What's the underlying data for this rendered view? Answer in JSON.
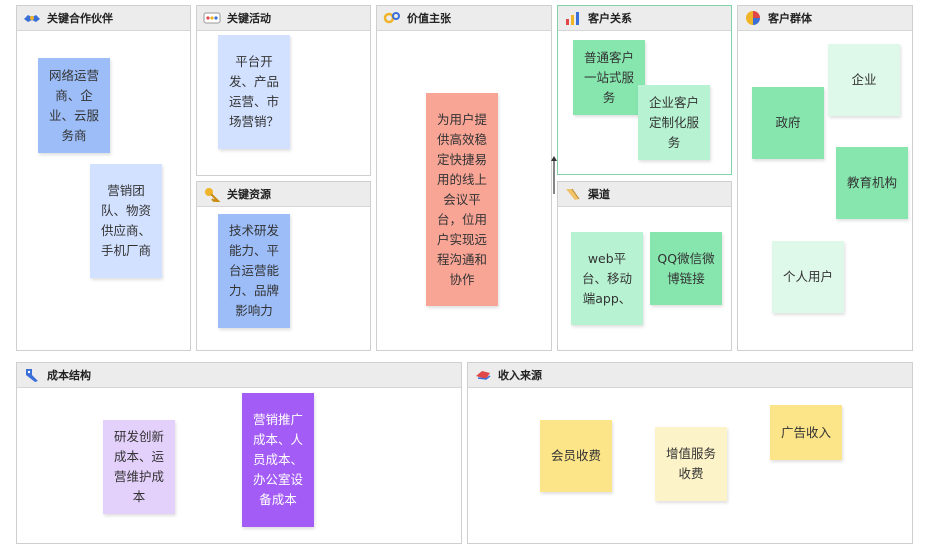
{
  "colors": {
    "panel_header": "#ececec",
    "panel_border": "#cfcfcf",
    "note_blue": "#9cbdf8",
    "note_light_blue": "#d2e1ff",
    "note_salmon": "#f8a596",
    "note_green": "#86e6ae",
    "note_mint": "#b7f3d2",
    "note_pale_green": "#def8ea",
    "note_lavender": "#e3d0fb",
    "note_purple": "#a35cf5",
    "note_yellow": "#fce488",
    "note_cream": "#fdf3c8"
  },
  "sections": {
    "key_partners": {
      "title": "关键合作伙伴",
      "icon": "handshake-icon",
      "notes": [
        "网络运营商、企业、云服务商",
        "营销团队、物资供应商、手机厂商"
      ]
    },
    "key_activities": {
      "title": "关键活动",
      "icon": "dots-icon",
      "notes": [
        "平台开发、产品运营、市场营销？"
      ]
    },
    "key_resources": {
      "title": "关键资源",
      "icon": "key-icon",
      "notes": [
        "技术研发能力、平台运营能力、品牌影响力"
      ]
    },
    "value_propositions": {
      "title": "价值主张",
      "icon": "gears-icon",
      "notes": [
        "为用户提供高效稳定快捷易用的线上会议平台，位用户实现远程沟通和协作"
      ]
    },
    "customer_relationships": {
      "title": "客户关系",
      "icon": "bar-chart-icon",
      "notes": [
        "普通客户一站式服务",
        "企业客户定制化服务"
      ]
    },
    "channels": {
      "title": "渠道",
      "icon": "paper-plane-icon",
      "notes": [
        "web平台、移动端app、",
        "QQ微信微博链接"
      ]
    },
    "customer_segments": {
      "title": "客户群体",
      "icon": "pie-chart-icon",
      "notes": [
        "企业",
        "政府",
        "教育机构",
        "个人用户"
      ]
    },
    "cost_structure": {
      "title": "成本结构",
      "icon": "tag-icon",
      "notes": [
        "研发创新成本、运营维护成本",
        "营销推广成本、人员成本、办公室设备成本"
      ]
    },
    "revenue_streams": {
      "title": "收入来源",
      "icon": "money-icon",
      "notes": [
        "会员收费",
        "增值服务收费",
        "广告收入"
      ]
    }
  }
}
